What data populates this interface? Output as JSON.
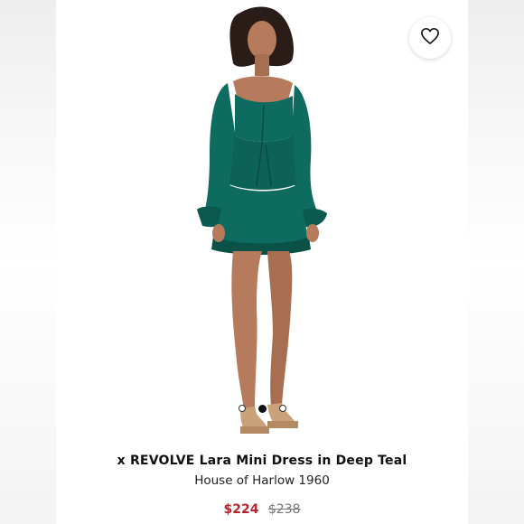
{
  "product": {
    "title": "x REVOLVE Lara Mini Dress in Deep Teal",
    "brand": "House of Harlow 1960",
    "sale_price": "$224",
    "original_price": "$238"
  },
  "gallery": {
    "image_count": 3,
    "active_index": 1
  },
  "colors": {
    "dress": "#0e6b5f",
    "dress_shadow": "#0a5148",
    "skin": "#b57b5c",
    "hair": "#2a1d17",
    "sale_price": "#b3262e"
  },
  "icons": {
    "favorite": "heart-outline-icon"
  }
}
